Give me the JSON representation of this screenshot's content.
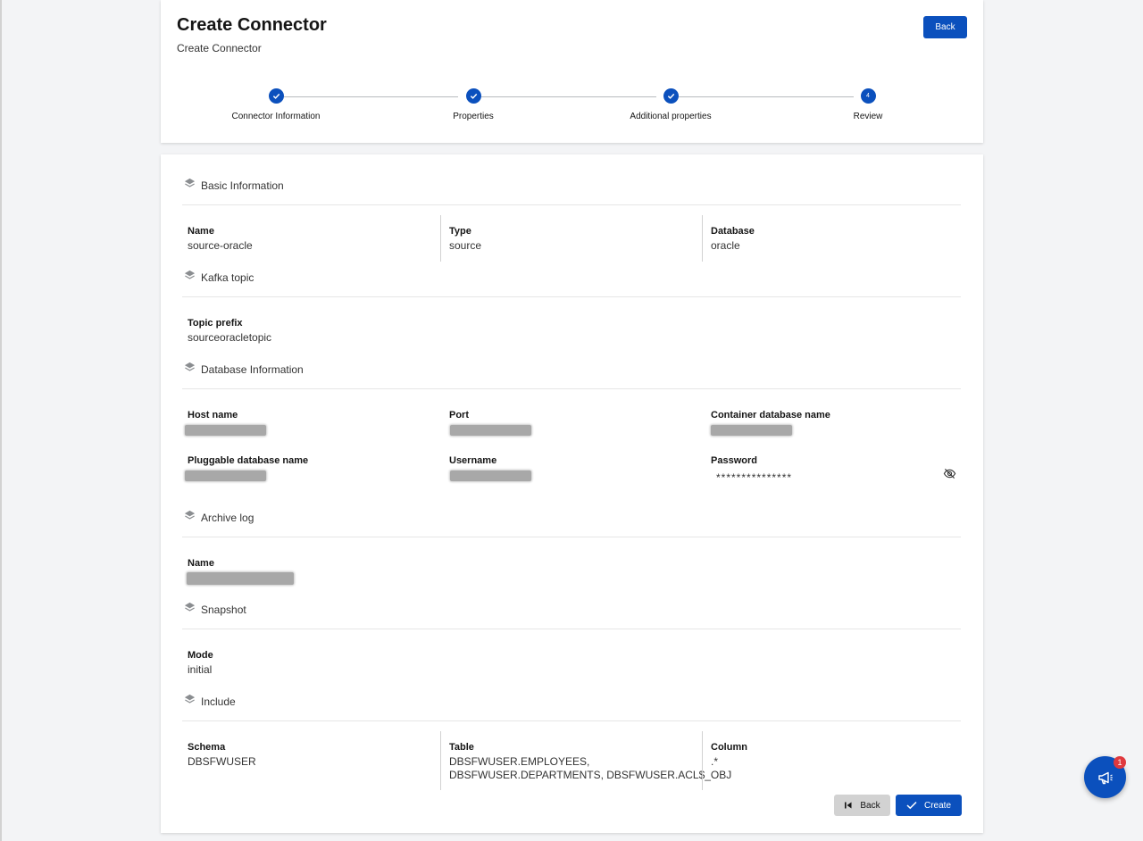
{
  "header": {
    "title": "Create Connector",
    "subtitle": "Create Connector",
    "back_label": "Back"
  },
  "stepper": {
    "steps": [
      {
        "label": "Connector Information",
        "state": "complete"
      },
      {
        "label": "Properties",
        "state": "complete"
      },
      {
        "label": "Additional properties",
        "state": "complete"
      },
      {
        "label": "Review",
        "state": "current",
        "number": "4"
      }
    ]
  },
  "review": {
    "basic": {
      "title": "Basic Information",
      "name_label": "Name",
      "name_value": "source-oracle",
      "type_label": "Type",
      "type_value": "source",
      "database_label": "Database",
      "database_value": "oracle"
    },
    "kafka": {
      "title": "Kafka topic",
      "topic_prefix_label": "Topic prefix",
      "topic_prefix_value": "sourceoracletopic"
    },
    "db_info": {
      "title": "Database Information",
      "host_label": "Host name",
      "port_label": "Port",
      "container_label": "Container database name",
      "pluggable_label": "Pluggable database name",
      "username_label": "Username",
      "password_label": "Password",
      "password_value": "***************"
    },
    "archive": {
      "title": "Archive log",
      "name_label": "Name"
    },
    "snapshot": {
      "title": "Snapshot",
      "mode_label": "Mode",
      "mode_value": "initial"
    },
    "include": {
      "title": "Include",
      "schema_label": "Schema",
      "schema_value": "DBSFWUSER",
      "table_label": "Table",
      "table_value_line1": "DBSFWUSER.EMPLOYEES,",
      "table_value_line2": "DBSFWUSER.DEPARTMENTS, DBSFWUSER.ACL$_OBJ",
      "column_label": "Column",
      "column_value": ".*"
    }
  },
  "actions": {
    "back_label": "Back",
    "create_label": "Create"
  },
  "notifications": {
    "badge_count": "1"
  },
  "colors": {
    "primary": "#0b50bd",
    "badge": "#e0393e",
    "background": "#f3f4f6"
  },
  "icons": {
    "step_complete": "check-icon",
    "section": "layers-icon",
    "password_toggle": "eye-slash-icon",
    "back": "skip-back-icon",
    "create": "check-icon",
    "fab": "megaphone-icon"
  }
}
